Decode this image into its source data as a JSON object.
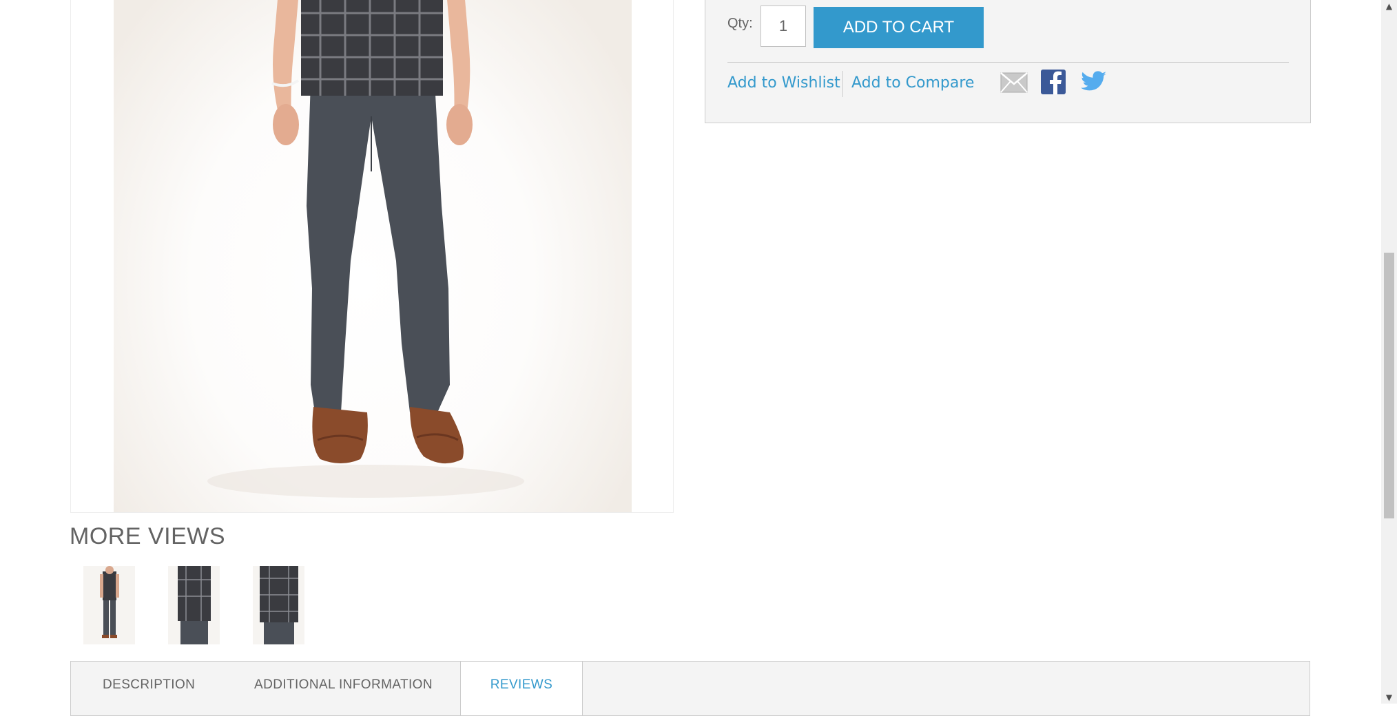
{
  "more_views": {
    "title": "MORE VIEWS",
    "thumbnails": [
      "front-view-thumbnail",
      "side-view-thumbnail",
      "back-view-thumbnail"
    ]
  },
  "cart": {
    "qty_label": "Qty:",
    "qty_value": "1",
    "add_to_cart_label": "ADD TO CART",
    "add_to_wishlist": "Add to Wishlist",
    "add_to_compare": "Add to Compare",
    "share_icons": [
      "email-icon",
      "facebook-icon",
      "twitter-icon"
    ]
  },
  "tabs": [
    {
      "label": "DESCRIPTION",
      "active": false
    },
    {
      "label": "ADDITIONAL INFORMATION",
      "active": false
    },
    {
      "label": "REVIEWS",
      "active": true
    }
  ],
  "colors": {
    "accent": "#3399cc",
    "text": "#636363",
    "panel_bg": "#f4f4f4",
    "border": "#cccccc",
    "facebook": "#3b5998",
    "twitter": "#55acee"
  }
}
